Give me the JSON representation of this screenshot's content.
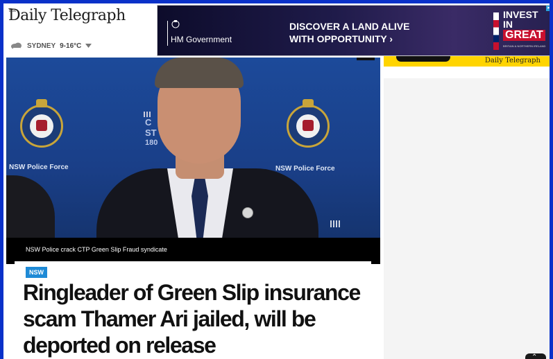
{
  "header": {
    "logo_small": "The",
    "logo": "Daily Telegraph",
    "weather": {
      "city": "SYDNEY",
      "temp": "9-16°C"
    }
  },
  "ad": {
    "gov": "HM Government",
    "headline_line1": "DISCOVER A LAND ALIVE",
    "headline_line2": "WITH OPPORTUNITY ›",
    "invest1": "INVEST",
    "invest2": "IN",
    "great": "GREAT",
    "great_sub": "BRITAIN & NORTHERN IRELAND"
  },
  "promo": {
    "text": "Daily Telegraph"
  },
  "hero": {
    "force_left": "NSW Police Force",
    "force_right": "NSW Police Force",
    "backdrop_text": [
      "C",
      "ST",
      "180"
    ],
    "caption": "NSW Police crack CTP Green Slip Fraud syndicate"
  },
  "article": {
    "category": "NSW",
    "title": "Ringleader of Green Slip insurance scam Thamer Ari jailed, will be deported on release"
  },
  "colors": {
    "frame": "#0a31c9",
    "tag": "#1e8ad6",
    "promo": "#ffd400"
  }
}
